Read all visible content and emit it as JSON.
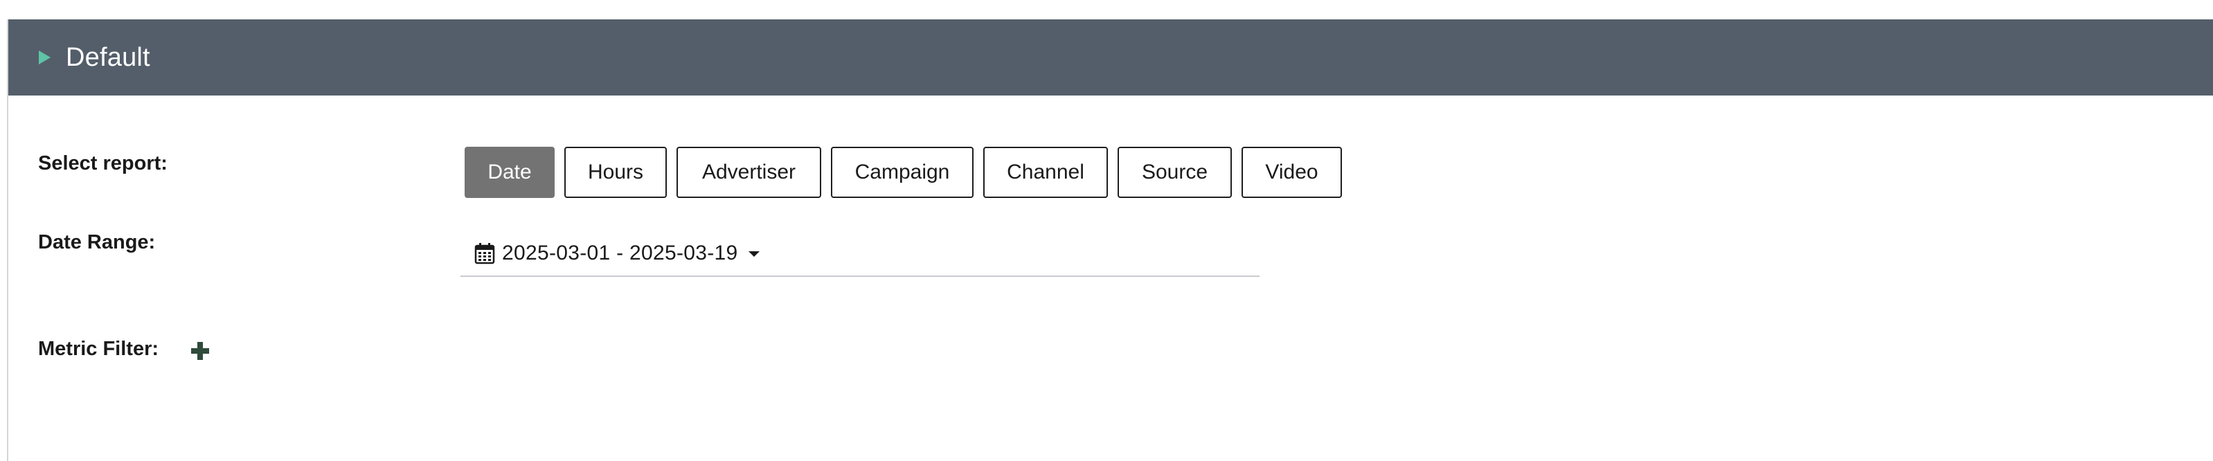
{
  "panel": {
    "title": "Default"
  },
  "form": {
    "select_report_label": "Select report:",
    "date_range_label": "Date Range:",
    "metric_filter_label": "Metric Filter:"
  },
  "report_buttons": [
    {
      "label": "Date",
      "active": true
    },
    {
      "label": "Hours",
      "active": false
    },
    {
      "label": "Advertiser",
      "active": false
    },
    {
      "label": "Campaign",
      "active": false
    },
    {
      "label": "Channel",
      "active": false
    },
    {
      "label": "Source",
      "active": false
    },
    {
      "label": "Video",
      "active": false
    }
  ],
  "date_range": {
    "value": "2025-03-01 - 2025-03-19",
    "icon": "calendar-icon"
  },
  "icons": {
    "panel_toggle": "triangle-right-icon",
    "add_filter": "plus-icon",
    "dropdown": "caret-down-icon"
  },
  "colors": {
    "header_bg": "#545e6a",
    "toggle_accent": "#5ec4a6",
    "active_button_bg": "#737373",
    "plus_icon": "#2f4a3a"
  }
}
